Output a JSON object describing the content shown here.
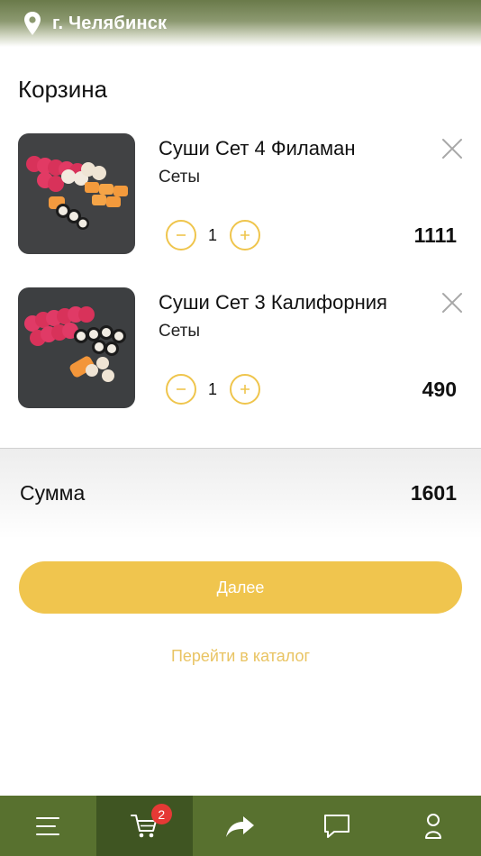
{
  "header": {
    "city": "г. Челябинск",
    "pin_icon": "location-pin-icon"
  },
  "cart": {
    "title": "Корзина",
    "items": [
      {
        "name": "Суши Сет 4 Филаман",
        "category": "Сеты",
        "quantity": "1",
        "price": "1111"
      },
      {
        "name": "Суши Сет 3 Калифорния",
        "category": "Сеты",
        "quantity": "1",
        "price": "490"
      }
    ],
    "sum_label": "Сумма",
    "sum_value": "1601",
    "next_label": "Далее",
    "catalog_link": "Перейти в каталог"
  },
  "bottom_nav": {
    "items": [
      {
        "icon": "menu-icon"
      },
      {
        "icon": "cart-icon",
        "badge": "2",
        "active": true
      },
      {
        "icon": "share-icon"
      },
      {
        "icon": "chat-icon"
      },
      {
        "icon": "user-icon"
      }
    ]
  },
  "colors": {
    "accent": "#f0c54e",
    "nav_bg": "#58712f",
    "nav_active": "#3f5522",
    "badge": "#e53935"
  }
}
